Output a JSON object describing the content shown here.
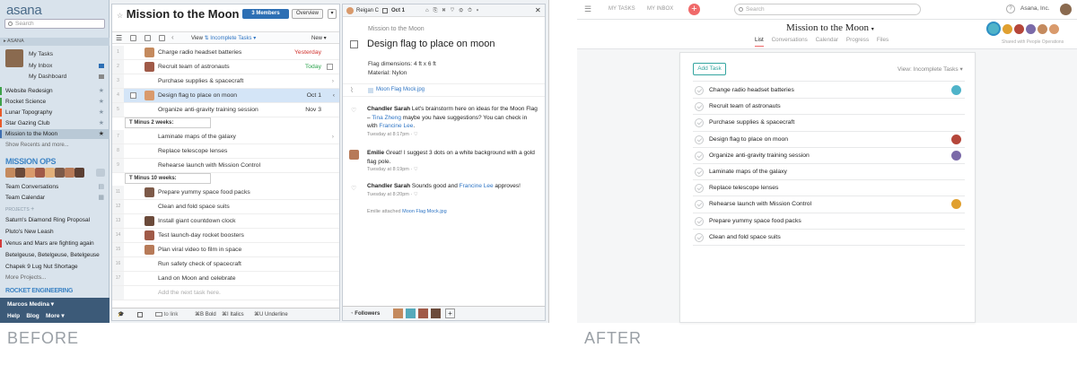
{
  "before": {
    "sidebar": {
      "logo": "asana",
      "search_placeholder": "Search",
      "workspace_header": "ASANA",
      "personal": [
        {
          "label": "My Tasks"
        },
        {
          "label": "My Inbox"
        },
        {
          "label": "My Dashboard"
        }
      ],
      "favorites": [
        {
          "label": "Website Redesign",
          "color": "#3fa14a"
        },
        {
          "label": "Rocket Science",
          "color": "#3fa14a"
        },
        {
          "label": "Lunar Topography",
          "color": "#e85b2b"
        },
        {
          "label": "Star Gazing Club",
          "color": "#e85b2b"
        },
        {
          "label": "Mission to the Moon",
          "color": "#3e6fb0"
        }
      ],
      "show_recents": "Show Recents and more...",
      "team_title": "MISSION OPS",
      "team_links": [
        "Team Conversations",
        "Team Calendar"
      ],
      "projects_header": "PROJECTS",
      "projects": [
        {
          "label": "Saturn's Diamond Ring Proposal",
          "color": "#d9e3ec"
        },
        {
          "label": "Pluto's New Leash",
          "color": "#d9e3ec"
        },
        {
          "label": "Venus and Mars are fighting again",
          "color": "#d33b3b"
        },
        {
          "label": "Betelgeuse, Betelgeuse, Betelgeuse",
          "color": "#d9e3ec"
        },
        {
          "label": "Chapek 9 Lug Nut Shortage",
          "color": "#d9e3ec"
        },
        {
          "label": "More Projects...",
          "color": "#d9e3ec"
        }
      ],
      "team2_title": "ROCKET ENGINEERING",
      "user": "Marcos Medina",
      "footer_links": [
        "Help",
        "Blog",
        "More"
      ]
    },
    "center": {
      "title": "Mission to the Moon",
      "members_btn": "3 Members",
      "overview_btn": "Overview",
      "view_label": "View",
      "view_filter": "Incomplete Tasks",
      "new_label": "New",
      "tasks": [
        {
          "text": "Charge radio headset batteries",
          "due": "Yesterday",
          "due_color": "#d0312d"
        },
        {
          "text": "Recruit team of astronauts",
          "due": "Today",
          "due_color": "#2ea44f"
        },
        {
          "text": "Purchase supplies & spacecraft",
          "due": "",
          "due_color": "#222"
        },
        {
          "text": "Design flag to place on moon",
          "due": "Oct 1",
          "due_color": "#222"
        },
        {
          "text": "Organize anti-gravity training session",
          "due": "Nov 3",
          "due_color": "#222"
        }
      ],
      "section1": "T Minus 2 weeks:",
      "tasks2": [
        {
          "text": "Laminate maps of the galaxy"
        },
        {
          "text": "Replace telescope lenses"
        },
        {
          "text": "Rehearse launch with Mission Control"
        }
      ],
      "section2": "T Minus 10 weeks:",
      "tasks3": [
        {
          "text": "Prepare yummy space food packs"
        },
        {
          "text": "Clean and fold space suits"
        },
        {
          "text": "Install giant countdown clock"
        },
        {
          "text": "Test launch-day rocket boosters"
        },
        {
          "text": "Plan viral video to film in space"
        },
        {
          "text": "Run safety check of spacecraft"
        },
        {
          "text": "Land on Moon and celebrate"
        }
      ],
      "add_placeholder": "Add the next task here.",
      "footer": {
        "link": "to link",
        "bold": "Bold",
        "italics": "Italics",
        "underline": "Underline",
        "bold_key": "⌘B",
        "italics_key": "⌘I",
        "underline_key": "⌘U"
      }
    },
    "detail": {
      "assignee": "Reigan C",
      "due": "Oct 1",
      "project": "Mission to the Moon",
      "task_title": "Design flag to place on moon",
      "description": [
        "Flag dimensions: 4 ft x 6 ft",
        "Material: Nylon"
      ],
      "attachment": "Moon Flag Mock.jpg",
      "comments": [
        {
          "author": "Chandler Sarah",
          "text1": "Let's brainstorm here on ideas for the Moon Flag –",
          "mention1": "Tina Zheng",
          "text2": "maybe you have suggestions? You can check in with",
          "mention2": "Francine Lee",
          "meta": "Tuesday at 8:17pm"
        },
        {
          "author": "Emilie",
          "text1": "Great! I suggest 3 dots on a white background with a gold flag pole.",
          "meta": "Tuesday at 8:19pm"
        },
        {
          "author": "Chandler Sarah",
          "text1": "Sounds good and",
          "mention1": "Francine Lee",
          "text2": "approves!",
          "meta": "Tuesday at 8:20pm"
        }
      ],
      "activity": "Emilie attached",
      "activity_file": "Moon Flag Mock.jpg",
      "followers_label": "Followers"
    }
  },
  "after": {
    "nav": {
      "my_tasks": "MY TASKS",
      "my_inbox": "MY INBOX",
      "search_placeholder": "Search",
      "help": "?",
      "org": "Asana, Inc."
    },
    "project_title": "Mission to the Moon",
    "tabs": [
      "List",
      "Conversations",
      "Calendar",
      "Progress",
      "Files"
    ],
    "shared_with": "Shared with People Operations",
    "add_task_btn": "Add Task",
    "view_filter": "View: Incomplete Tasks",
    "tasks": [
      {
        "text": "Change radio headset batteries",
        "avatar_color": "#4fb3c9"
      },
      {
        "text": "Recruit team of astronauts",
        "avatar_color": ""
      },
      {
        "text": "Purchase supplies & spacecraft",
        "avatar_color": ""
      },
      {
        "text": "Design flag to place on moon",
        "avatar_color": "#b5463a"
      },
      {
        "text": "Organize anti-gravity training session",
        "avatar_color": "#7b6aa8"
      },
      {
        "text": "Laminate maps of the galaxy",
        "avatar_color": ""
      },
      {
        "text": "Replace telescope lenses",
        "avatar_color": ""
      },
      {
        "text": "Rehearse launch with Mission Control",
        "avatar_color": "#e0a030"
      },
      {
        "text": "Prepare yummy space food packs",
        "avatar_color": ""
      },
      {
        "text": "Clean and fold space suits",
        "avatar_color": ""
      }
    ]
  },
  "captions": {
    "before": "BEFORE",
    "after": "AFTER"
  }
}
